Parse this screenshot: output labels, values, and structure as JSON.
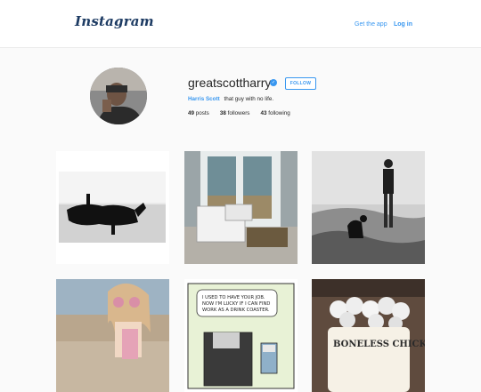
{
  "header": {
    "logo": "Instagram",
    "get_app": "Get the app",
    "login": "Log in"
  },
  "profile": {
    "username": "greatscottharry",
    "verified_icon": "✓",
    "follow_label": "FOLLOW",
    "full_name": "Harris Scott",
    "bio": "that guy with no life.",
    "stats": {
      "posts_count": "49",
      "posts_label": "posts",
      "followers_count": "38",
      "followers_label": "followers",
      "following_count": "43",
      "following_label": "following"
    }
  },
  "posts": [
    {
      "description": "black dog lying on rug"
    },
    {
      "description": "boxes by glass door"
    },
    {
      "description": "man with puppy on hillside"
    },
    {
      "description": "girl with sunglasses on beach"
    },
    {
      "description": "comic floppy disk",
      "caption_lines": [
        "I USED TO HAVE YOUR JOB.",
        "NOW I'M LUCKY IF I CAN FIND",
        "WORK AS A DRINK COASTER."
      ]
    },
    {
      "description": "boneless chicken sign with eggs",
      "sign_text": "BONELESS CHICKEN"
    }
  ],
  "colors": {
    "accent": "#3897f0",
    "logo": "#1d3b63",
    "background": "#fafafa"
  }
}
